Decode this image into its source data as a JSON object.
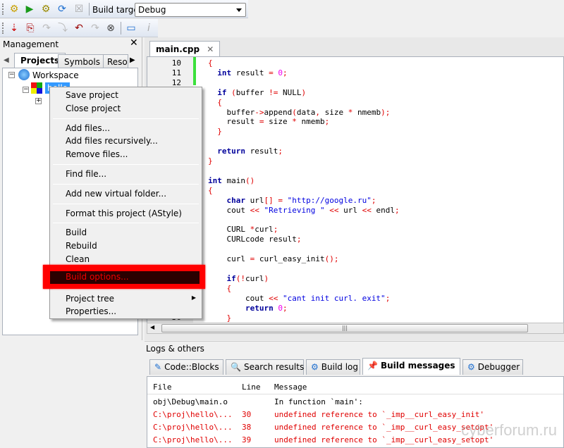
{
  "toolbar1": {
    "icons": [
      "gear-build-icon",
      "run-icon",
      "build-run-icon",
      "rebuild-icon",
      "abort-icon"
    ],
    "build_target_label": "Build target:",
    "build_target_value": "Debug"
  },
  "toolbar2": {
    "icons": [
      "debug-start-icon",
      "run-to-cursor-icon",
      "next-line-icon",
      "step-into-icon",
      "step-out-icon",
      "next-instruction-icon",
      "stop-debugger-icon",
      "debug-windows-icon",
      "info-icon"
    ]
  },
  "management": {
    "title": "Management",
    "tabs": [
      "Projects",
      "Symbols",
      "Resou"
    ],
    "workspace": "Workspace",
    "project": "hello"
  },
  "context_menu": {
    "groups": [
      [
        "Save project",
        "Close project"
      ],
      [
        "Add files...",
        "Add files recursively...",
        "Remove files..."
      ],
      [
        "Find file..."
      ],
      [
        "Add new virtual folder..."
      ],
      [
        "Format this project (AStyle)"
      ],
      [
        "Build",
        "Rebuild",
        "Clean"
      ]
    ],
    "highlighted": "Build options...",
    "tail": [
      "Project tree",
      "Properties..."
    ],
    "highlight_color": "#ff0000"
  },
  "editor": {
    "tab": "main.cpp",
    "first_line": 10,
    "lines": [
      "{",
      "  int result = 0;",
      "",
      "  if (buffer != NULL)",
      "  {",
      "    buffer->append(data, size * nmemb);",
      "    result = size * nmemb;",
      "  }",
      "",
      "  return result;",
      "}",
      "",
      "int main()",
      "{",
      "    char url[] = \"http://google.ru\";",
      "    cout << \"Retrieving \" << url << endl;",
      "",
      "    CURL *curl;",
      "    CURLcode result;",
      "",
      "    curl = curl_easy_init();",
      "",
      "    if(!curl)",
      "    {",
      "        cout << \"cant init curl. exit\";",
      "        return 0;",
      "    }"
    ]
  },
  "logs": {
    "title": "Logs & others",
    "tabs": [
      "Code::Blocks",
      "Search results",
      "Build log",
      "Build messages",
      "Debugger"
    ],
    "active_tab": "Build messages",
    "columns": [
      "File",
      "Line",
      "Message"
    ],
    "rows": [
      {
        "file": "obj\\Debug\\main.o",
        "line": "",
        "message": "In function `main':",
        "error": false
      },
      {
        "file": "C:\\proj\\hello\\...",
        "line": "30",
        "message": "undefined reference to `_imp__curl_easy_init'",
        "error": true
      },
      {
        "file": "C:\\proj\\hello\\...",
        "line": "38",
        "message": "undefined reference to `_imp__curl_easy_setopt'",
        "error": true
      },
      {
        "file": "C:\\proj\\hello\\...",
        "line": "39",
        "message": "undefined reference to `_imp__curl_easy_setopt'",
        "error": true
      }
    ]
  },
  "watermark": "cyberforum.ru"
}
